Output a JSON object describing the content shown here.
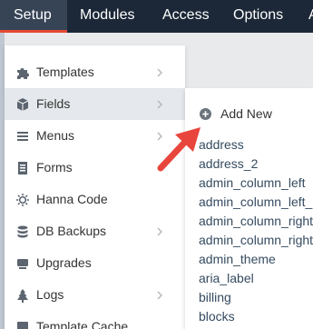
{
  "topnav": {
    "items": [
      {
        "label": "Setup"
      },
      {
        "label": "Modules"
      },
      {
        "label": "Access"
      },
      {
        "label": "Options"
      },
      {
        "label": "A"
      }
    ]
  },
  "setup_menu": {
    "items": [
      {
        "label": "Templates",
        "icon": "puzzle-icon"
      },
      {
        "label": "Fields",
        "icon": "cube-icon"
      },
      {
        "label": "Menus",
        "icon": "bars-icon"
      },
      {
        "label": "Forms",
        "icon": "form-icon"
      },
      {
        "label": "Hanna Code",
        "icon": "sun-icon"
      },
      {
        "label": "DB Backups",
        "icon": "database-icon"
      },
      {
        "label": "Upgrades",
        "icon": "upgrade-icon"
      },
      {
        "label": "Logs",
        "icon": "tree-icon"
      },
      {
        "label": "Template Cache",
        "icon": "cache-icon"
      }
    ]
  },
  "fields_submenu": {
    "add_new_label": "Add New",
    "fields": [
      "address",
      "address_2",
      "admin_column_left",
      "admin_column_left_B",
      "admin_column_right",
      "admin_column_right",
      "admin_theme",
      "aria_label",
      "billing",
      "blocks"
    ]
  },
  "colors": {
    "topnav_bg": "#1c2837",
    "active_underline": "#e54933",
    "annotation_arrow": "#e8453c",
    "field_text": "#354b60"
  }
}
